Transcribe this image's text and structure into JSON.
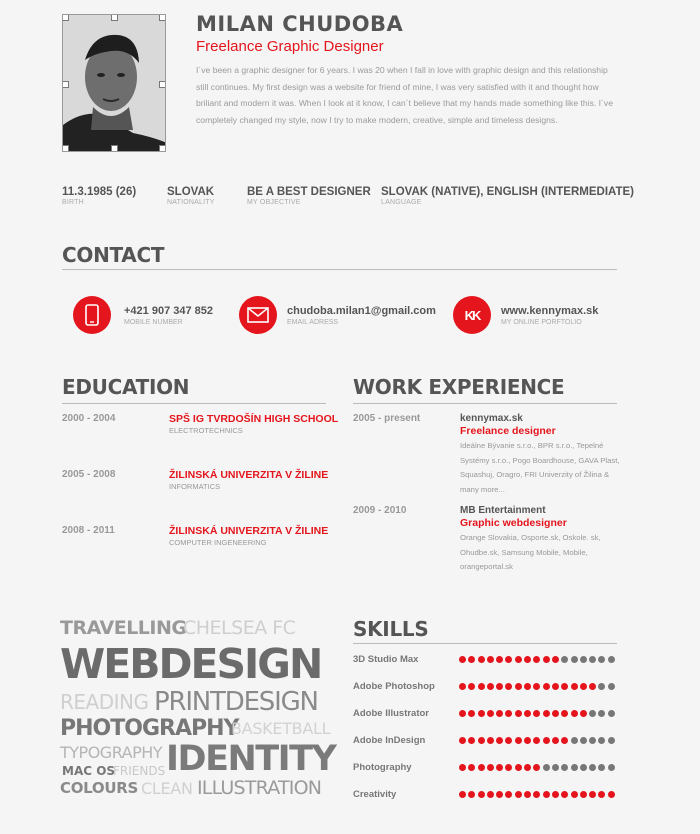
{
  "header": {
    "name": "MILAN CHUDOBA",
    "job_title": "Freelance Graphic Designer",
    "intro": "I´ve been a graphic designer for 6 years. I was 20 when I fall in love with graphic design and this relationship still continues. My first design was a website for friend of mine, I was very satisfied with it and thought how briliant and modern it was. When I look at it know, I can´t believe that my hands made something like this. I´ve completely changed my style, now I try to make modern, creative, simple and timeless designs."
  },
  "info": [
    {
      "value": "11.3.1985 (26)",
      "label": "BIRTH"
    },
    {
      "value": "SLOVAK",
      "label": "NATIONALITY"
    },
    {
      "value": "BE A BEST DESIGNER",
      "label": "MY OBJECTIVE"
    },
    {
      "value": "SLOVAK (NATIVE), ENGLISH (INTERMEDIATE)",
      "label": "LANGUAGE"
    }
  ],
  "contact": {
    "title": "CONTACT",
    "items": [
      {
        "value": "+421 907 347 852",
        "label": "MOBILE NUMBER",
        "icon": "mobile-phone-icon"
      },
      {
        "value": "chudoba.milan1@gmail.com",
        "label": "EMAIL ADRESS",
        "icon": "envelope-icon"
      },
      {
        "value": "www.kennymax.sk",
        "label": "MY ONLINE PORFTOLIO",
        "icon": "kennymax-logo-icon",
        "glyph": "KK"
      }
    ]
  },
  "education": {
    "title": "EDUCATION",
    "items": [
      {
        "years": "2000 - 2004",
        "school": "SPŠ IG TVRDOŠÍN HIGH SCHOOL",
        "field": "ELECTROTECHNICS"
      },
      {
        "years": "2005 - 2008",
        "school": "ŽILINSKÁ UNIVERZITA V ŽILINE",
        "field": "INFORMATICS"
      },
      {
        "years": "2008 - 2011",
        "school": "ŽILINSKÁ UNIVERZITA V ŽILINE",
        "field": "COMPUTER INGENEERING"
      }
    ]
  },
  "work": {
    "title": "WORK EXPERIENCE",
    "items": [
      {
        "years": "2005 - present",
        "company": "kennymax.sk",
        "position": "Freelance designer",
        "desc": "Ideálne Bývanie s.r.o., BPR s.r.o., Tepelné Systémy s.r.o., Pogo Boardhouse, GAVA Plast,  Squashuj, Oragro, FRI Univerzity of Žilina & many more..."
      },
      {
        "years": "2009 - 2010",
        "company": "MB Entertainment",
        "position": "Graphic webdesigner",
        "desc": "Orange Slovakia, Osporte.sk, Oskole. sk, Ohudbe.sk, Samsung Mobile, Mobile, orangeportal.sk"
      }
    ]
  },
  "interests": {
    "words": [
      "TRAVELLING",
      "CHELSEA FC",
      "WEBDESIGN",
      "READING",
      "PRINTDESIGN",
      "PHOTOGRAPHY",
      "BASKETBALL",
      "TYPOGRAPHY",
      "MAC OS",
      "FRIENDS",
      "IDENTITY",
      "COLOURS",
      "CLEAN",
      "ILLUSTRATION"
    ]
  },
  "skills": {
    "title": "SKILLS",
    "total": 17,
    "colors": {
      "filled": "#e4151c",
      "empty": "#777777"
    },
    "items": [
      {
        "name": "3D Studio Max",
        "level": 11
      },
      {
        "name": "Adobe Photoshop",
        "level": 15
      },
      {
        "name": "Adobe Illustrator",
        "level": 14
      },
      {
        "name": "Adobe InDesign",
        "level": 12
      },
      {
        "name": "Photography",
        "level": 9
      },
      {
        "name": "Creativity",
        "level": 17
      }
    ]
  },
  "colors": {
    "accent": "#e4151c",
    "text": "#555555",
    "muted": "#999999"
  }
}
